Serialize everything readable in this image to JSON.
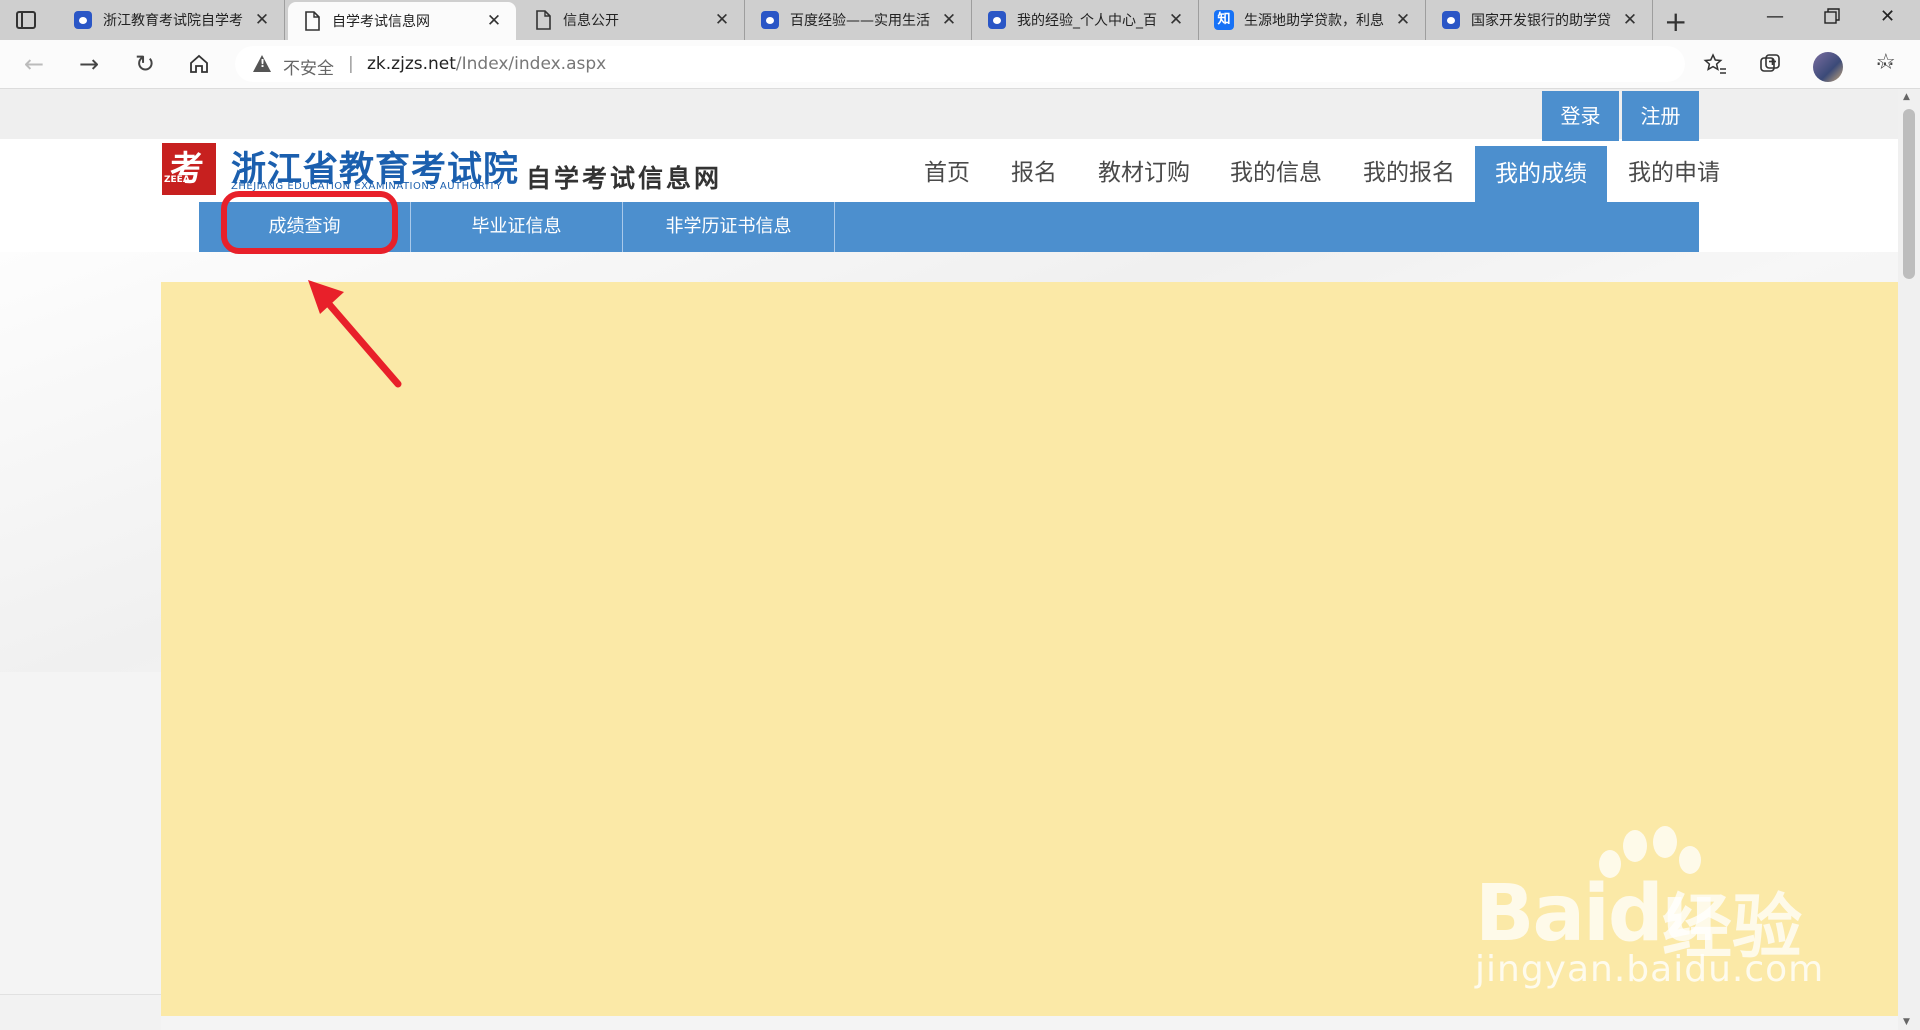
{
  "browser": {
    "tabs": [
      {
        "title": "浙江教育考试院自学考",
        "icon": "baidu-icon",
        "active": false
      },
      {
        "title": "自学考试信息网",
        "icon": "page-icon",
        "active": true
      },
      {
        "title": "信息公开",
        "icon": "page-icon",
        "active": false
      },
      {
        "title": "百度经验——实用生活",
        "icon": "baidu-icon",
        "active": false
      },
      {
        "title": "我的经验_个人中心_百",
        "icon": "baidu-icon",
        "active": false
      },
      {
        "title": "生源地助学贷款，利息",
        "icon": "zhihu-icon",
        "active": false
      },
      {
        "title": "国家开发银行的助学贷",
        "icon": "baidu-icon",
        "active": false
      }
    ],
    "zhihu_glyph": "知",
    "insecure_label": "不安全",
    "url_host": "zk.zjzs.net",
    "url_path": "/Index/index.aspx"
  },
  "site": {
    "login": "登录",
    "register": "注册",
    "logo_mark": "考",
    "logo_abbr": "ZEEA",
    "logo_title": "浙江省教育考试院",
    "logo_en": "ZHEJIANG EDUCATION EXAMINATIONS AUTHORITY",
    "logo_subtitle": "自学考试信息网",
    "nav": [
      "首页",
      "报名",
      "教材订购",
      "我的信息",
      "我的报名",
      "我的成绩",
      "我的申请"
    ],
    "nav_active_index": 5,
    "subnav": [
      "成绩查询",
      "毕业证信息",
      "非学历证书信息"
    ]
  },
  "watermark": {
    "brand": "Bai",
    "brand2": "du",
    "jingyan": "经验",
    "url": "jingyan.baidu.com"
  },
  "colors": {
    "nav_blue": "#4c8fce",
    "content_yellow": "#fbe9a7",
    "annotation_red": "#e8202a"
  }
}
